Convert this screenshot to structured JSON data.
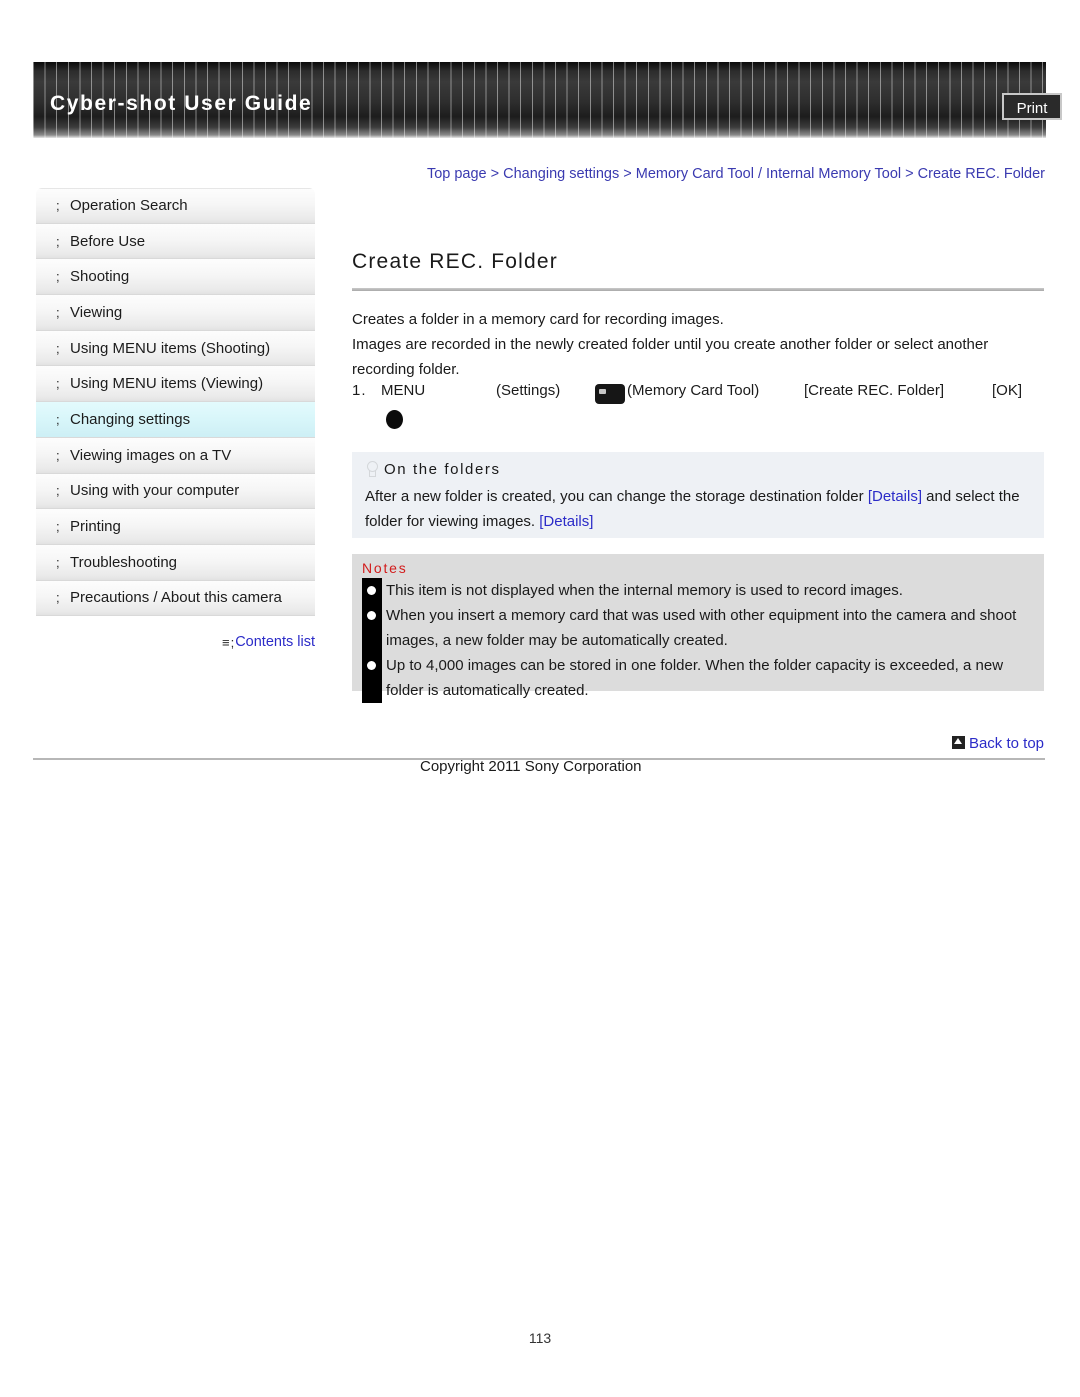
{
  "header": {
    "title": "Cyber-shot User Guide",
    "print_label": "Print"
  },
  "breadcrumb": {
    "text": "Top page > Changing settings > Memory Card Tool / Internal Memory Tool > Create REC. Folder"
  },
  "sidebar": {
    "marker": ";",
    "items": [
      {
        "label": "Operation Search",
        "active": false
      },
      {
        "label": "Before Use",
        "active": false
      },
      {
        "label": "Shooting",
        "active": false
      },
      {
        "label": "Viewing",
        "active": false
      },
      {
        "label": "Using MENU items (Shooting)",
        "active": false
      },
      {
        "label": "Using MENU items (Viewing)",
        "active": false
      },
      {
        "label": "Changing settings",
        "active": true
      },
      {
        "label": "Viewing images on a TV",
        "active": false
      },
      {
        "label": "Using with your computer",
        "active": false
      },
      {
        "label": "Printing",
        "active": false
      },
      {
        "label": "Troubleshooting",
        "active": false
      },
      {
        "label": "Precautions / About this camera",
        "active": false
      }
    ],
    "contents_list_label": "Contents list",
    "contents_list_icon": "list-icon"
  },
  "main": {
    "title": "Create REC. Folder",
    "intro_line_1": "Creates a folder in a memory card for recording images.",
    "intro_line_2": "Images are recorded in the newly created folder until you create another folder or select another recording folder.",
    "step": {
      "number": "1.",
      "menu": "MENU",
      "settings": "(Settings)",
      "memory_card_tool": "(Memory Card Tool)",
      "create_rec_folder": "[Create REC. Folder]",
      "ok": "[OK]"
    },
    "tip": {
      "heading": "On the folders",
      "text_before_link1": "After a new folder is created, you can change the storage destination folder ",
      "link1": "[Details]",
      "text_between": " and select the folder for viewing images. ",
      "link2": "[Details]"
    },
    "notes": {
      "heading": "Notes",
      "items": [
        "This item is not displayed when the internal memory is used to record images.",
        "When you insert a memory card that was used with other equipment into the camera and shoot images, a new folder may be automatically created.",
        "Up to 4,000 images can be stored in one folder. When the folder capacity is exceeded, a new folder is automatically created."
      ]
    }
  },
  "footer": {
    "back_to_top_label": "Back to top",
    "copyright": "Copyright 2011 Sony Corporation",
    "page_number": "113"
  },
  "colors": {
    "link": "#2b2bc8",
    "breadcrumb": "#3a3ab0",
    "notes_heading": "#d21c1c",
    "active_nav": "#d8f6fa",
    "notes_bg": "#dcdcdc",
    "tip_bg": "#eef1f5"
  }
}
